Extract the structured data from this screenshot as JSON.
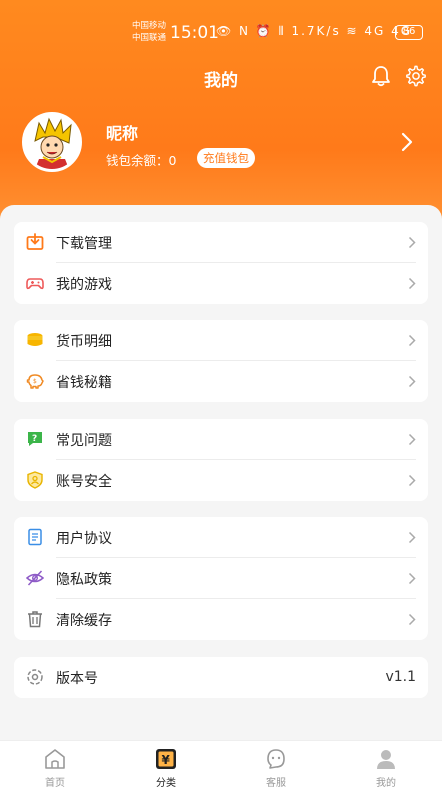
{
  "status_bar": {
    "carrier_1": "中国移动",
    "carrier_2": "中国联通",
    "time": "15:01",
    "icons": "👁 N ⏰ ⫴ 1.7K/s ≋ 4G 4G",
    "battery": "86"
  },
  "header": {
    "title": "我的"
  },
  "profile": {
    "nickname": "昵称",
    "wallet_label": "钱包余额：0",
    "recharge_label": "充值钱包"
  },
  "menu": {
    "download": "下载管理",
    "my_games": "我的游戏",
    "currency": "货币明细",
    "savings": "省钱秘籍",
    "faq": "常见问题",
    "security": "账号安全",
    "agreement": "用户协议",
    "privacy": "隐私政策",
    "clear_cache": "清除缓存",
    "version_label": "版本号",
    "version_value": "v1.1"
  },
  "tabbar": {
    "home": "首页",
    "category": "分类",
    "service": "客服",
    "mine": "我的"
  },
  "colors": {
    "accent": "#ff7a1a",
    "background": "#f5f5f5"
  },
  "icons": [
    "bell-icon",
    "gear-icon",
    "chevron-right-icon",
    "download-icon",
    "gamepad-icon",
    "coin-icon",
    "piggy-bank-icon",
    "question-icon",
    "shield-icon",
    "document-icon",
    "eye-off-icon",
    "trash-icon",
    "version-icon",
    "home-icon",
    "category-icon",
    "service-icon",
    "user-icon"
  ]
}
